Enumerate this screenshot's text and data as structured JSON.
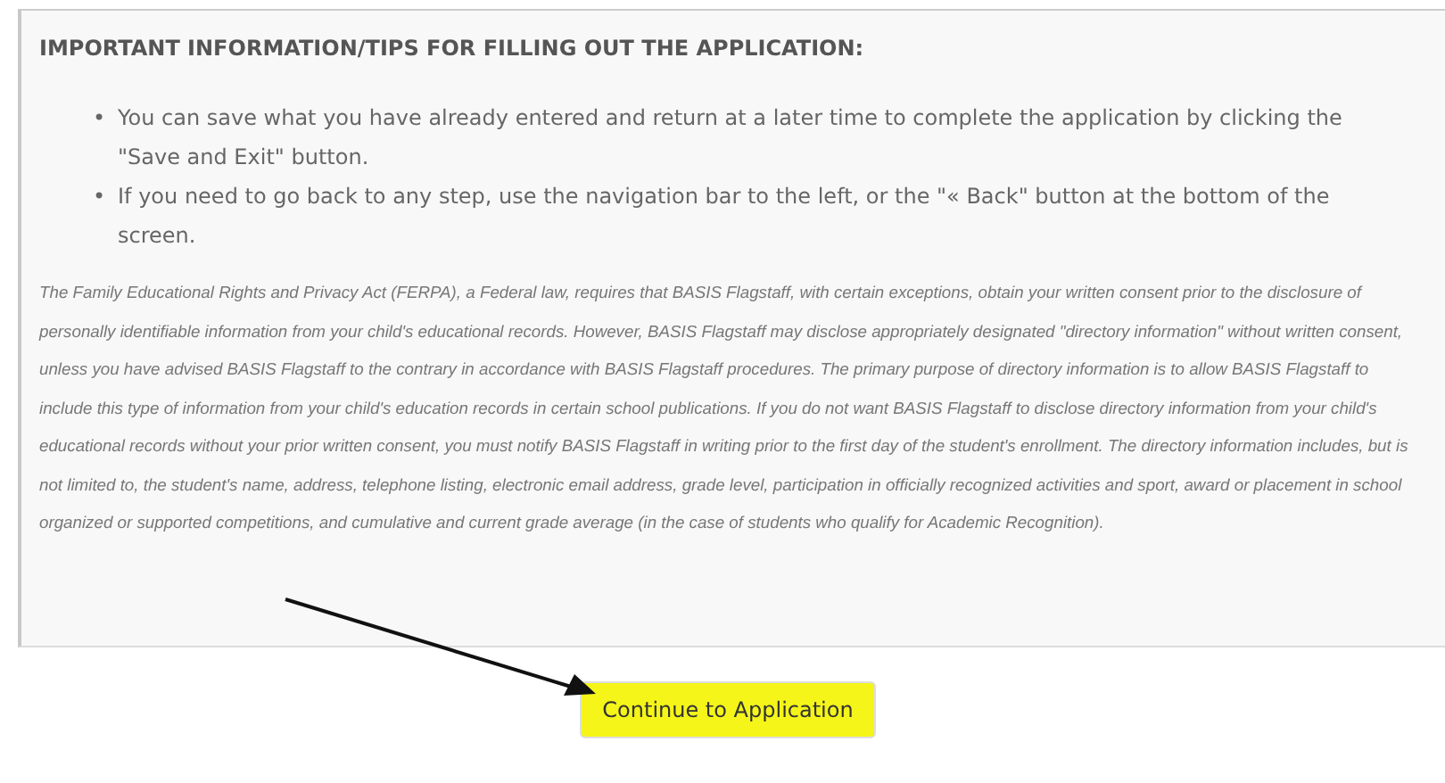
{
  "panel": {
    "heading": "IMPORTANT INFORMATION/TIPS FOR FILLING OUT THE APPLICATION:",
    "tips": [
      {
        "bullet": "•",
        "text": "You can save what you have already entered and return at a later time to complete the application by clicking the \"Save and Exit\" button."
      },
      {
        "bullet": "•",
        "text": "If you need to go back to any step, use the navigation bar to the left, or the \"« Back\" button at the bottom of the screen."
      }
    ],
    "notice": "The Family Educational Rights and Privacy Act (FERPA), a Federal law, requires that BASIS Flagstaff, with certain exceptions, obtain your written consent prior to the disclosure of personally identifiable information from your child's educational records. However, BASIS Flagstaff may disclose appropriately designated \"directory information\" without written consent, unless you have advised BASIS Flagstaff to the contrary in accordance with BASIS Flagstaff procedures. The primary purpose of directory information is to allow BASIS Flagstaff to include this type of information from your child's education records in certain school publications. If you do not want BASIS Flagstaff to disclose directory information from your child's educational records without your prior written consent, you must notify BASIS Flagstaff in writing prior to the first day of the student's enrollment. The directory information includes, but is not limited to, the student's name, address, telephone listing, electronic email address, grade level, participation in officially recognized activities and sport, award or placement in school organized or supported competitions, and cumulative and current grade average (in the case of students who qualify for Academic Recognition)."
  },
  "continue_button": {
    "label": "Continue to Application",
    "highlighted": true
  }
}
